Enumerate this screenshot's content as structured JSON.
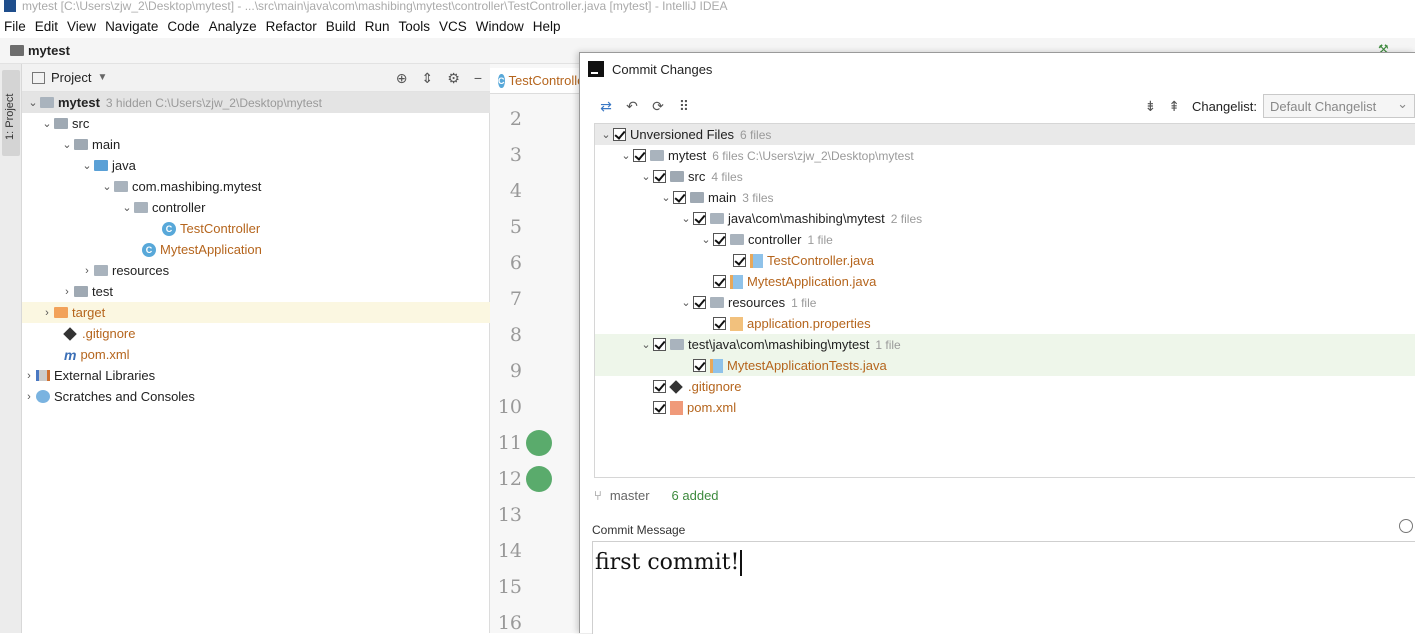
{
  "window": {
    "title": "mytest [C:\\Users\\zjw_2\\Desktop\\mytest] - ...\\src\\main\\java\\com\\mashibing\\mytest\\controller\\TestController.java [mytest] - IntelliJ IDEA"
  },
  "menu": [
    "File",
    "Edit",
    "View",
    "Navigate",
    "Code",
    "Analyze",
    "Refactor",
    "Build",
    "Run",
    "Tools",
    "VCS",
    "Window",
    "Help"
  ],
  "navbar": {
    "project": "mytest"
  },
  "stripe": {
    "project_tab": "1: Project"
  },
  "project_panel": {
    "header": "Project",
    "tree": {
      "root_name": "mytest",
      "root_meta": "3 hidden  C:\\Users\\zjw_2\\Desktop\\mytest",
      "src": "src",
      "main": "main",
      "java": "java",
      "package": "com.mashibing.mytest",
      "controller": "controller",
      "test_controller": "TestController",
      "mytest_application": "MytestApplication",
      "resources": "resources",
      "test": "test",
      "target": "target",
      "gitignore": ".gitignore",
      "pom": "pom.xml",
      "external_libraries": "External Libraries",
      "scratches": "Scratches and Consoles"
    }
  },
  "editor": {
    "tab_label": "TestController",
    "line_numbers": [
      "2",
      "3",
      "4",
      "5",
      "6",
      "7",
      "8",
      "9",
      "10",
      "11",
      "12",
      "13",
      "14",
      "15",
      "16"
    ]
  },
  "commit_dialog": {
    "title": "Commit Changes",
    "changelist_label": "Changelist:",
    "changelist_value": "Default Changelist",
    "changes": {
      "unversioned_label": "Unversioned Files",
      "unversioned_count": "6 files",
      "mytest": "mytest",
      "mytest_meta": "6 files  C:\\Users\\zjw_2\\Desktop\\mytest",
      "src": "src",
      "src_meta": "4 files",
      "main": "main",
      "main_meta": "3 files",
      "java_path": "java\\com\\mashibing\\mytest",
      "java_meta": "2 files",
      "controller": "controller",
      "controller_meta": "1 file",
      "test_controller_file": "TestController.java",
      "mytest_application_file": "MytestApplication.java",
      "resources": "resources",
      "resources_meta": "1 file",
      "application_properties": "application.properties",
      "test_path": "test\\java\\com\\mashibing\\mytest",
      "test_meta": "1 file",
      "mytest_application_tests": "MytestApplicationTests.java",
      "gitignore": ".gitignore",
      "pom": "pom.xml"
    },
    "branch": "master",
    "summary": "6 added",
    "commit_message_label": "Commit Message",
    "commit_message": "first commit!"
  }
}
